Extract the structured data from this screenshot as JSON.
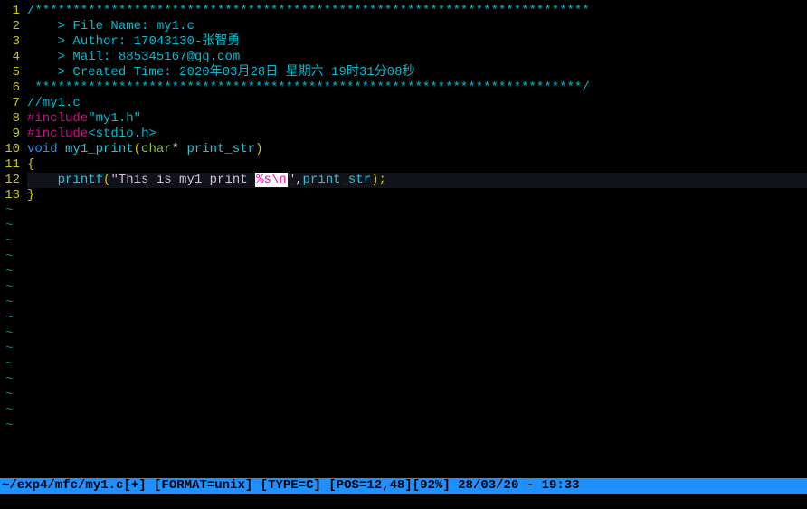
{
  "file": {
    "path": "~/exp4/mfc/my1.c",
    "modified_flag": "[+]"
  },
  "header": {
    "border_top": "/*************************************************************************",
    "filename_label": "> File Name:",
    "filename_value": "my1.c",
    "author_label": "> Author:",
    "author_value": "17043130-张智勇",
    "mail_label": "> Mail:",
    "mail_value": "885345167@qq.com",
    "created_label": "> Created Time:",
    "created_value": "2020年03月28日 星期六 19时31分08秒",
    "border_bottom": " ************************************************************************/"
  },
  "code": {
    "comment": "//my1.c",
    "include1_directive": "#include",
    "include1_file": "\"my1.h\"",
    "include2_directive": "#include",
    "include2_file": "<stdio.h>",
    "func_return": "void",
    "func_name": "my1_print",
    "func_param_type": "char",
    "func_param_star": "*",
    "func_param_name": "print_str",
    "brace_open": "{",
    "printf_name": "printf",
    "printf_string_pre": "\"This is my1 print ",
    "printf_escape": "%s\\n",
    "printf_string_post": "\"",
    "printf_arg": "print_str",
    "brace_close": "}"
  },
  "line_numbers": [
    "1",
    "2",
    "3",
    "4",
    "5",
    "6",
    "7",
    "8",
    "9",
    "10",
    "11",
    "12",
    "13"
  ],
  "tilde": "~",
  "tilde_count": 15,
  "status": {
    "format": "[FORMAT=unix]",
    "type": "[TYPE=C]",
    "pos": "[POS=12,48]",
    "percent": "[92%]",
    "date": "28/03/20",
    "sep": " - ",
    "time": "19:33"
  }
}
